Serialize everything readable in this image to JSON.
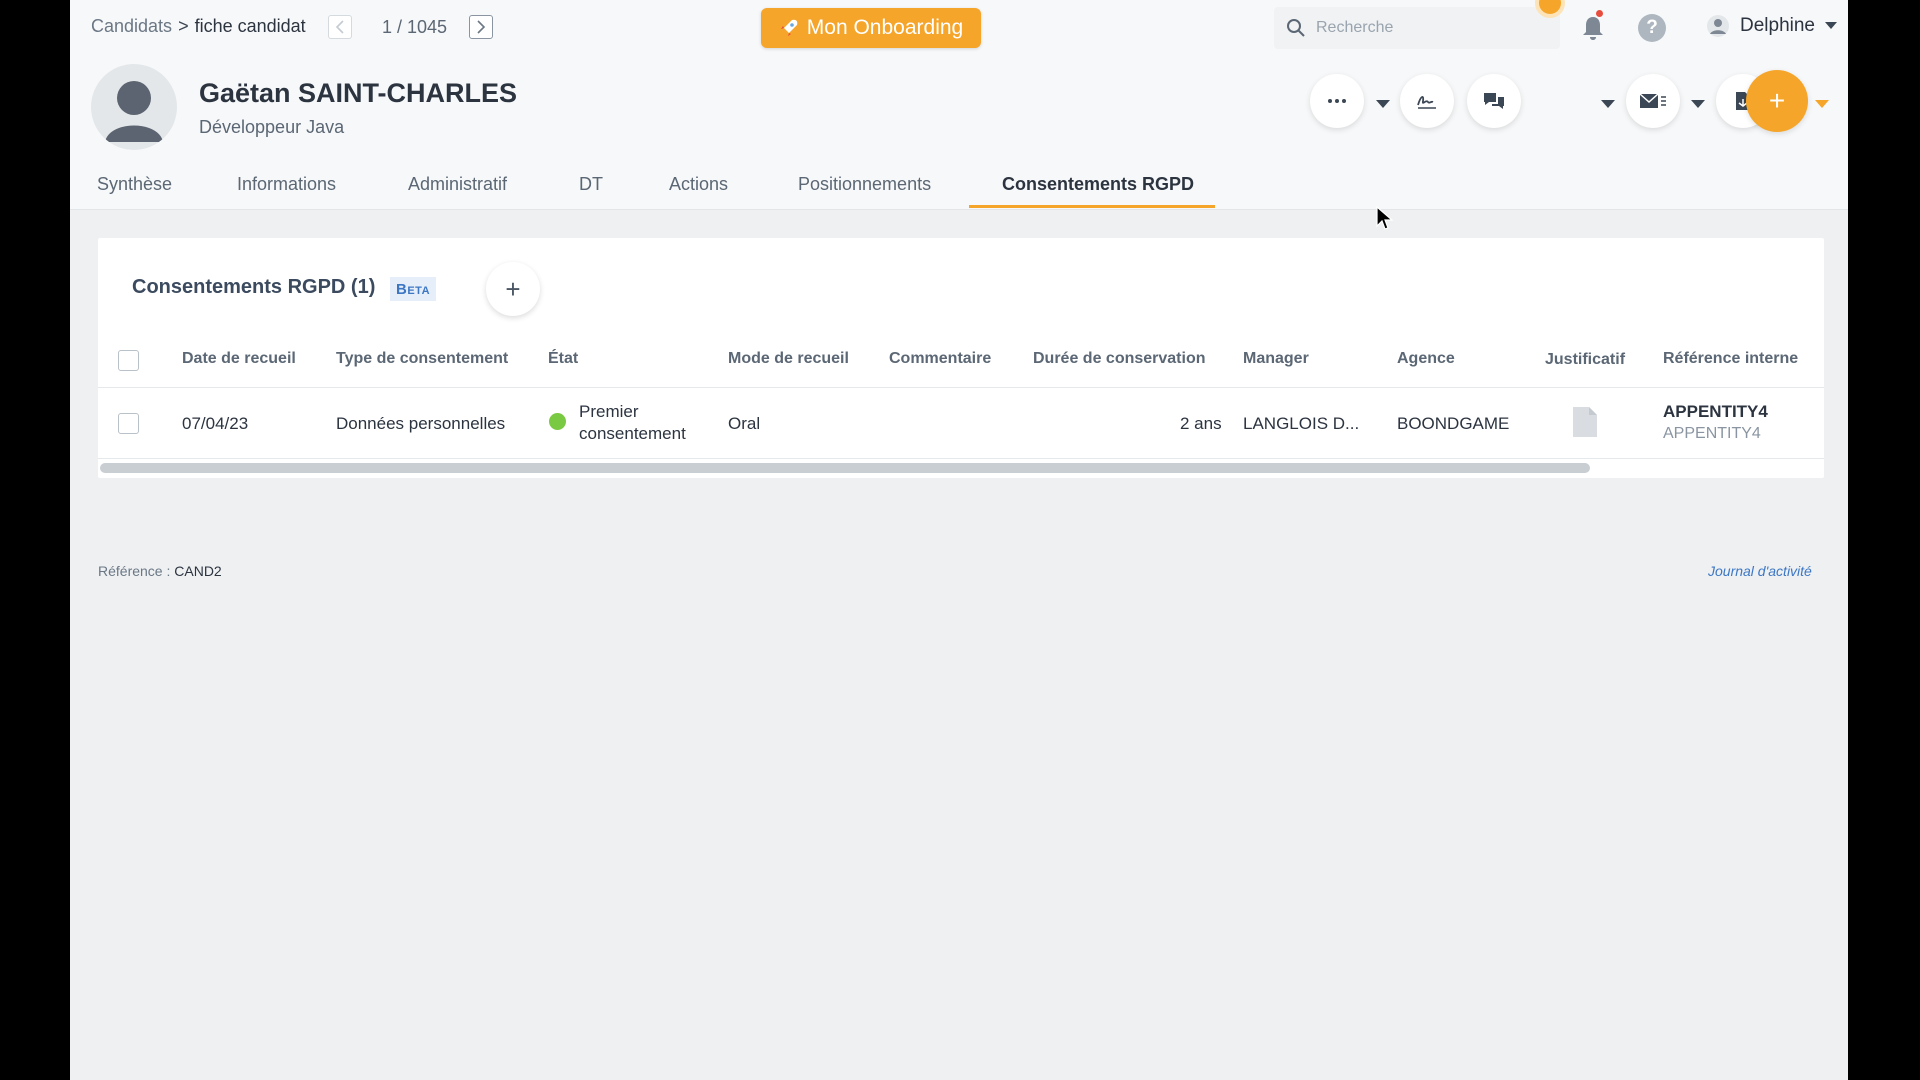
{
  "breadcrumb": {
    "parent": "Candidats",
    "separator": ">",
    "current": "fiche candidat"
  },
  "pager": {
    "position": "1 / 1045"
  },
  "onboarding": {
    "label": "Mon Onboarding"
  },
  "search": {
    "placeholder": "Recherche"
  },
  "user": {
    "name": "Delphine"
  },
  "candidate": {
    "name": "Gaëtan SAINT-CHARLES",
    "title": "Développeur Java"
  },
  "tabs": [
    {
      "label": "Synthèse"
    },
    {
      "label": "Informations"
    },
    {
      "label": "Administratif"
    },
    {
      "label": "DT"
    },
    {
      "label": "Actions"
    },
    {
      "label": "Positionnements"
    },
    {
      "label": "Consentements RGPD"
    }
  ],
  "active_tab": "Consentements RGPD",
  "panel": {
    "title": "Consentements RGPD (1)",
    "badge": "Beta",
    "add_label": "+"
  },
  "table": {
    "headers": [
      "Date de recueil",
      "Type de consentement",
      "État",
      "Mode de recueil",
      "Commentaire",
      "Durée de conservation",
      "Manager",
      "Agence",
      "Justificatif",
      "Référence interne"
    ],
    "rows": [
      {
        "date": "07/04/23",
        "type": "Données personnelles",
        "state_line1": "Premier",
        "state_line2": "consentement",
        "state_color": "#7ac943",
        "mode": "Oral",
        "comment": "",
        "duration": "2 ans",
        "manager": "LANGLOIS D...",
        "agency": "BOONDGAME",
        "justificatif_icon": "document-icon",
        "ref_primary": "APPENTITY4",
        "ref_secondary": "APPENTITY4"
      }
    ]
  },
  "footer": {
    "ref_label": "Référence :",
    "ref_value": "CAND2",
    "journal": "Journal d'activité"
  },
  "colors": {
    "accent": "#f5a52a",
    "link": "#3d77c4",
    "status_ok": "#7ac943"
  }
}
